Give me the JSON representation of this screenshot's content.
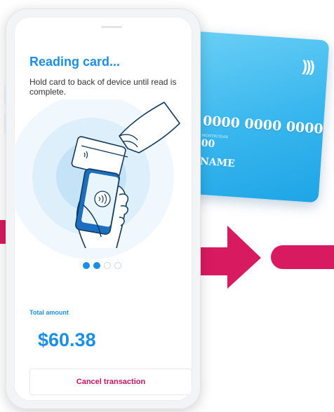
{
  "screen": {
    "title": "Reading card...",
    "instruction": "Hold card to back of device until read is complete."
  },
  "card": {
    "number": "0000 0000 0000",
    "valid_label": "MONTH/YEAR",
    "expiry": "00",
    "name": "NAME"
  },
  "pagination": {
    "total": 4,
    "active": 2
  },
  "payment": {
    "total_label": "Total amount",
    "amount": "$60.38"
  },
  "actions": {
    "cancel_label": "Cancel transaction"
  },
  "colors": {
    "accent": "#1b8fe8",
    "arrow": "#d81b60",
    "card": "#38b6ee",
    "cancel_text": "#c8155f"
  },
  "icons": [
    "contactless-icon",
    "arrow-right-icon",
    "hand-holding-card",
    "hand-holding-phone"
  ]
}
